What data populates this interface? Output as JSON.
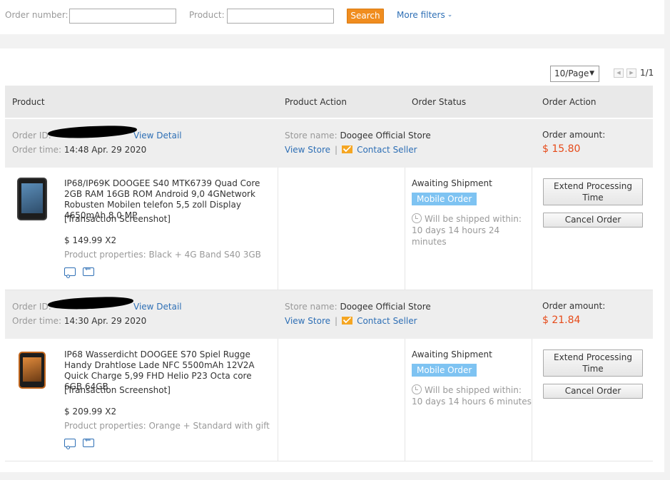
{
  "filters": {
    "order_number_label": "Order number:",
    "order_number_value": "",
    "product_label": "Product:",
    "product_value": "",
    "search_label": "Search",
    "more_filters_label": "More filters",
    "more_filters_icon": "chevron-down-icon"
  },
  "pagination": {
    "page_size": "10/Page",
    "page_info": "1/1"
  },
  "table_headers": [
    "Product",
    "Product Action",
    "Order Status",
    "Order Action"
  ],
  "orders": [
    {
      "order_id_label": "Order ID:",
      "view_detail": "View Detail",
      "order_time_label": "Order time:",
      "order_time": "14:48 Apr. 29 2020",
      "store_name_label": "Store name:",
      "store_name": "Doogee Official Store",
      "view_store": "View Store",
      "contact_seller": "Contact Seller",
      "amount_label": "Order amount:",
      "amount": "$ 15.80",
      "product_title": "IP68/IP69K DOOGEE S40 MTK6739 Quad Core 2GB RAM 16GB ROM Android 9,0 4GNetwork Robusten Mobilen telefon 5,5 zoll Display 4650mAh 8,0 MP",
      "transaction_screenshot": "[Transaction Screenshot]",
      "price": "$ 149.99 X2",
      "properties_label": "Product properties:",
      "properties": "Black + 4G Band S40 3GB",
      "status": "Awaiting Shipment",
      "badge": "Mobile Order",
      "ship_text": "Will be shipped within: 10 days 14 hours 24 minutes",
      "extend_label": "Extend Processing Time",
      "cancel_label": "Cancel Order"
    },
    {
      "order_id_label": "Order ID:",
      "view_detail": "View Detail",
      "order_time_label": "Order time:",
      "order_time": "14:30 Apr. 29 2020",
      "store_name_label": "Store name:",
      "store_name": "Doogee Official Store",
      "view_store": "View Store",
      "contact_seller": "Contact Seller",
      "amount_label": "Order amount:",
      "amount": "$ 21.84",
      "product_title": "IP68 Wasserdicht DOOGEE S70 Spiel Rugge Handy Drahtlose Lade NFC 5500mAh 12V2A Quick Charge 5,99 FHD Helio P23 Octa core 6GB 64GB",
      "transaction_screenshot": "[Transaction Screenshot]",
      "price": "$ 209.99 X2",
      "properties_label": "Product properties:",
      "properties": "Orange + Standard with gift",
      "status": "Awaiting Shipment",
      "badge": "Mobile Order",
      "ship_text": "Will be shipped within: 10 days 14 hours 6 minutes",
      "extend_label": "Extend Processing Time",
      "cancel_label": "Cancel Order"
    }
  ],
  "colors": {
    "accent_orange": "#f08d1f",
    "link_blue": "#2e6fb5",
    "amount_red": "#e64a19",
    "badge_blue": "#7ec3f2"
  }
}
